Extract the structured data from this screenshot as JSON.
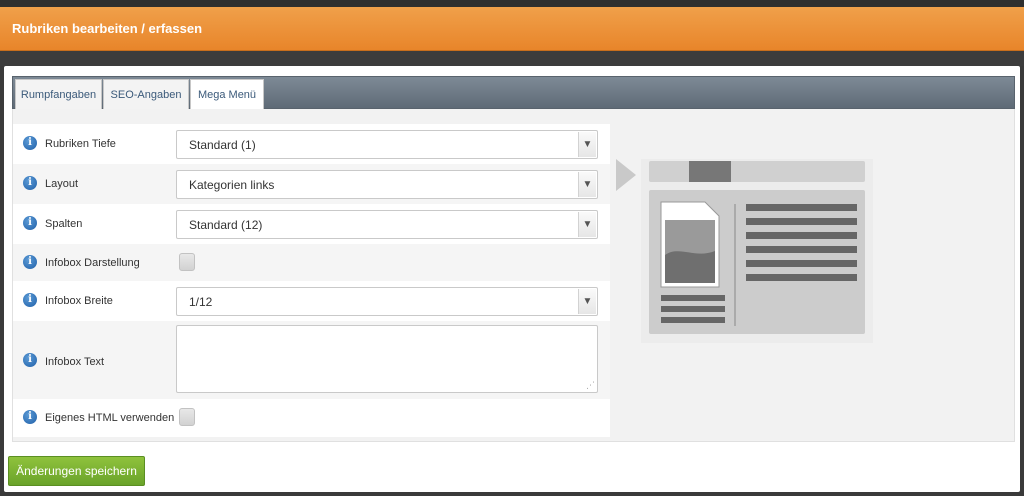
{
  "page": {
    "title": "Rubriken bearbeiten / erfassen"
  },
  "tabs": [
    {
      "label": "Rumpfangaben",
      "active": false
    },
    {
      "label": "SEO-Angaben",
      "active": false
    },
    {
      "label": "Mega Menü",
      "active": true
    }
  ],
  "form": {
    "rubriken_tiefe": {
      "label": "Rubriken Tiefe",
      "value": "Standard (1)"
    },
    "layout": {
      "label": "Layout",
      "value": "Kategorien links"
    },
    "spalten": {
      "label": "Spalten",
      "value": "Standard (12)"
    },
    "infobox_darstellung": {
      "label": "Infobox Darstellung",
      "checked": false
    },
    "infobox_breite": {
      "label": "Infobox Breite",
      "value": "1/12"
    },
    "infobox_text": {
      "label": "Infobox Text",
      "value": ""
    },
    "eigenes_html": {
      "label": "Eigenes HTML verwenden",
      "checked": false
    }
  },
  "info_icon_glyph": "i",
  "save_label": "Änderungen speichern",
  "colors": {
    "title_bar": "#e8852a",
    "tab_bar": "#6b7782",
    "save_button": "#78b02f",
    "info_icon": "#2a6db5"
  }
}
